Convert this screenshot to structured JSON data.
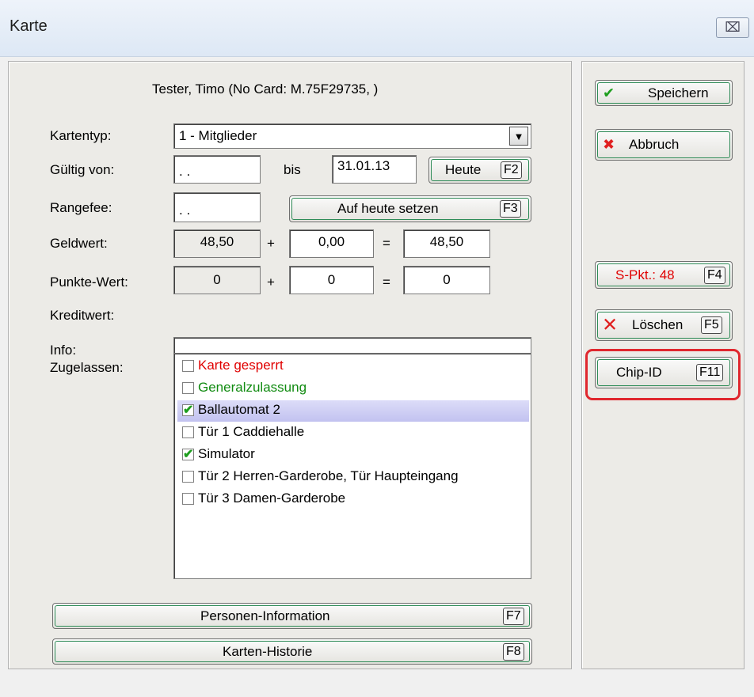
{
  "window": {
    "title": "Karte",
    "close_glyph": "⌧"
  },
  "header": {
    "person_line": "Tester, Timo (No Card: M.75F29735, )"
  },
  "form": {
    "kartentyp_label": "Kartentyp:",
    "kartentyp_value": "1 - Mitglieder",
    "gueltig_label": "Gültig von:",
    "gueltig_von_value": ". .",
    "bis_label": "bis",
    "bis_value": "31.01.13",
    "heute_label": "Heute",
    "heute_key": "F2",
    "rangefee_label": "Rangefee:",
    "rangefee_value": ". .",
    "auf_heute_label": "Auf heute setzen",
    "auf_heute_key": "F3",
    "geldwert_label": "Geldwert:",
    "geldwert_value": "48,50",
    "geldwert_add": "0,00",
    "geldwert_total": "48,50",
    "punkte_label": "Punkte-Wert:",
    "punkte_value": "0",
    "punkte_add": "0",
    "punkte_total": "0",
    "plus": "+",
    "equals": "=",
    "kredit_label": "Kreditwert:",
    "info_label": "Info:",
    "info_value": "",
    "zugelassen_label": "Zugelassen:"
  },
  "zugelassen_items": [
    {
      "label": "Karte gesperrt",
      "checked": false,
      "color": "#e00000",
      "selected": false
    },
    {
      "label": "Generalzulassung",
      "checked": false,
      "color": "#118b11",
      "selected": false
    },
    {
      "label": "Ballautomat 2",
      "checked": true,
      "color": "#000000",
      "selected": true
    },
    {
      "label": "Tür 1 Caddiehalle",
      "checked": false,
      "color": "#000000",
      "selected": false
    },
    {
      "label": "Simulator",
      "checked": true,
      "color": "#000000",
      "selected": false
    },
    {
      "label": "Tür 2 Herren-Garderobe, Tür Haupteingang",
      "checked": false,
      "color": "#000000",
      "selected": false
    },
    {
      "label": "Tür 3 Damen-Garderobe",
      "checked": false,
      "color": "#000000",
      "selected": false
    }
  ],
  "bottom_buttons": {
    "personen_label": "Personen-Information",
    "personen_key": "F7",
    "historie_label": "Karten-Historie",
    "historie_key": "F8"
  },
  "side_buttons": {
    "speichern_label": "Speichern",
    "abbruch_label": "Abbruch",
    "spkt_label": "S-Pkt.: 48",
    "spkt_key": "F4",
    "loeschen_label": "Löschen",
    "loeschen_key": "F5",
    "chip_label": "Chip-ID",
    "chip_key": "F11"
  },
  "icons": {
    "check": "✔",
    "cross_bold": "✖",
    "cross": "✕",
    "dropdown": "▼",
    "checkmark": "✔"
  },
  "colors": {
    "accent_green": "#2e8b57",
    "highlight_red": "#e0272e",
    "spkt_red": "#e00000"
  }
}
